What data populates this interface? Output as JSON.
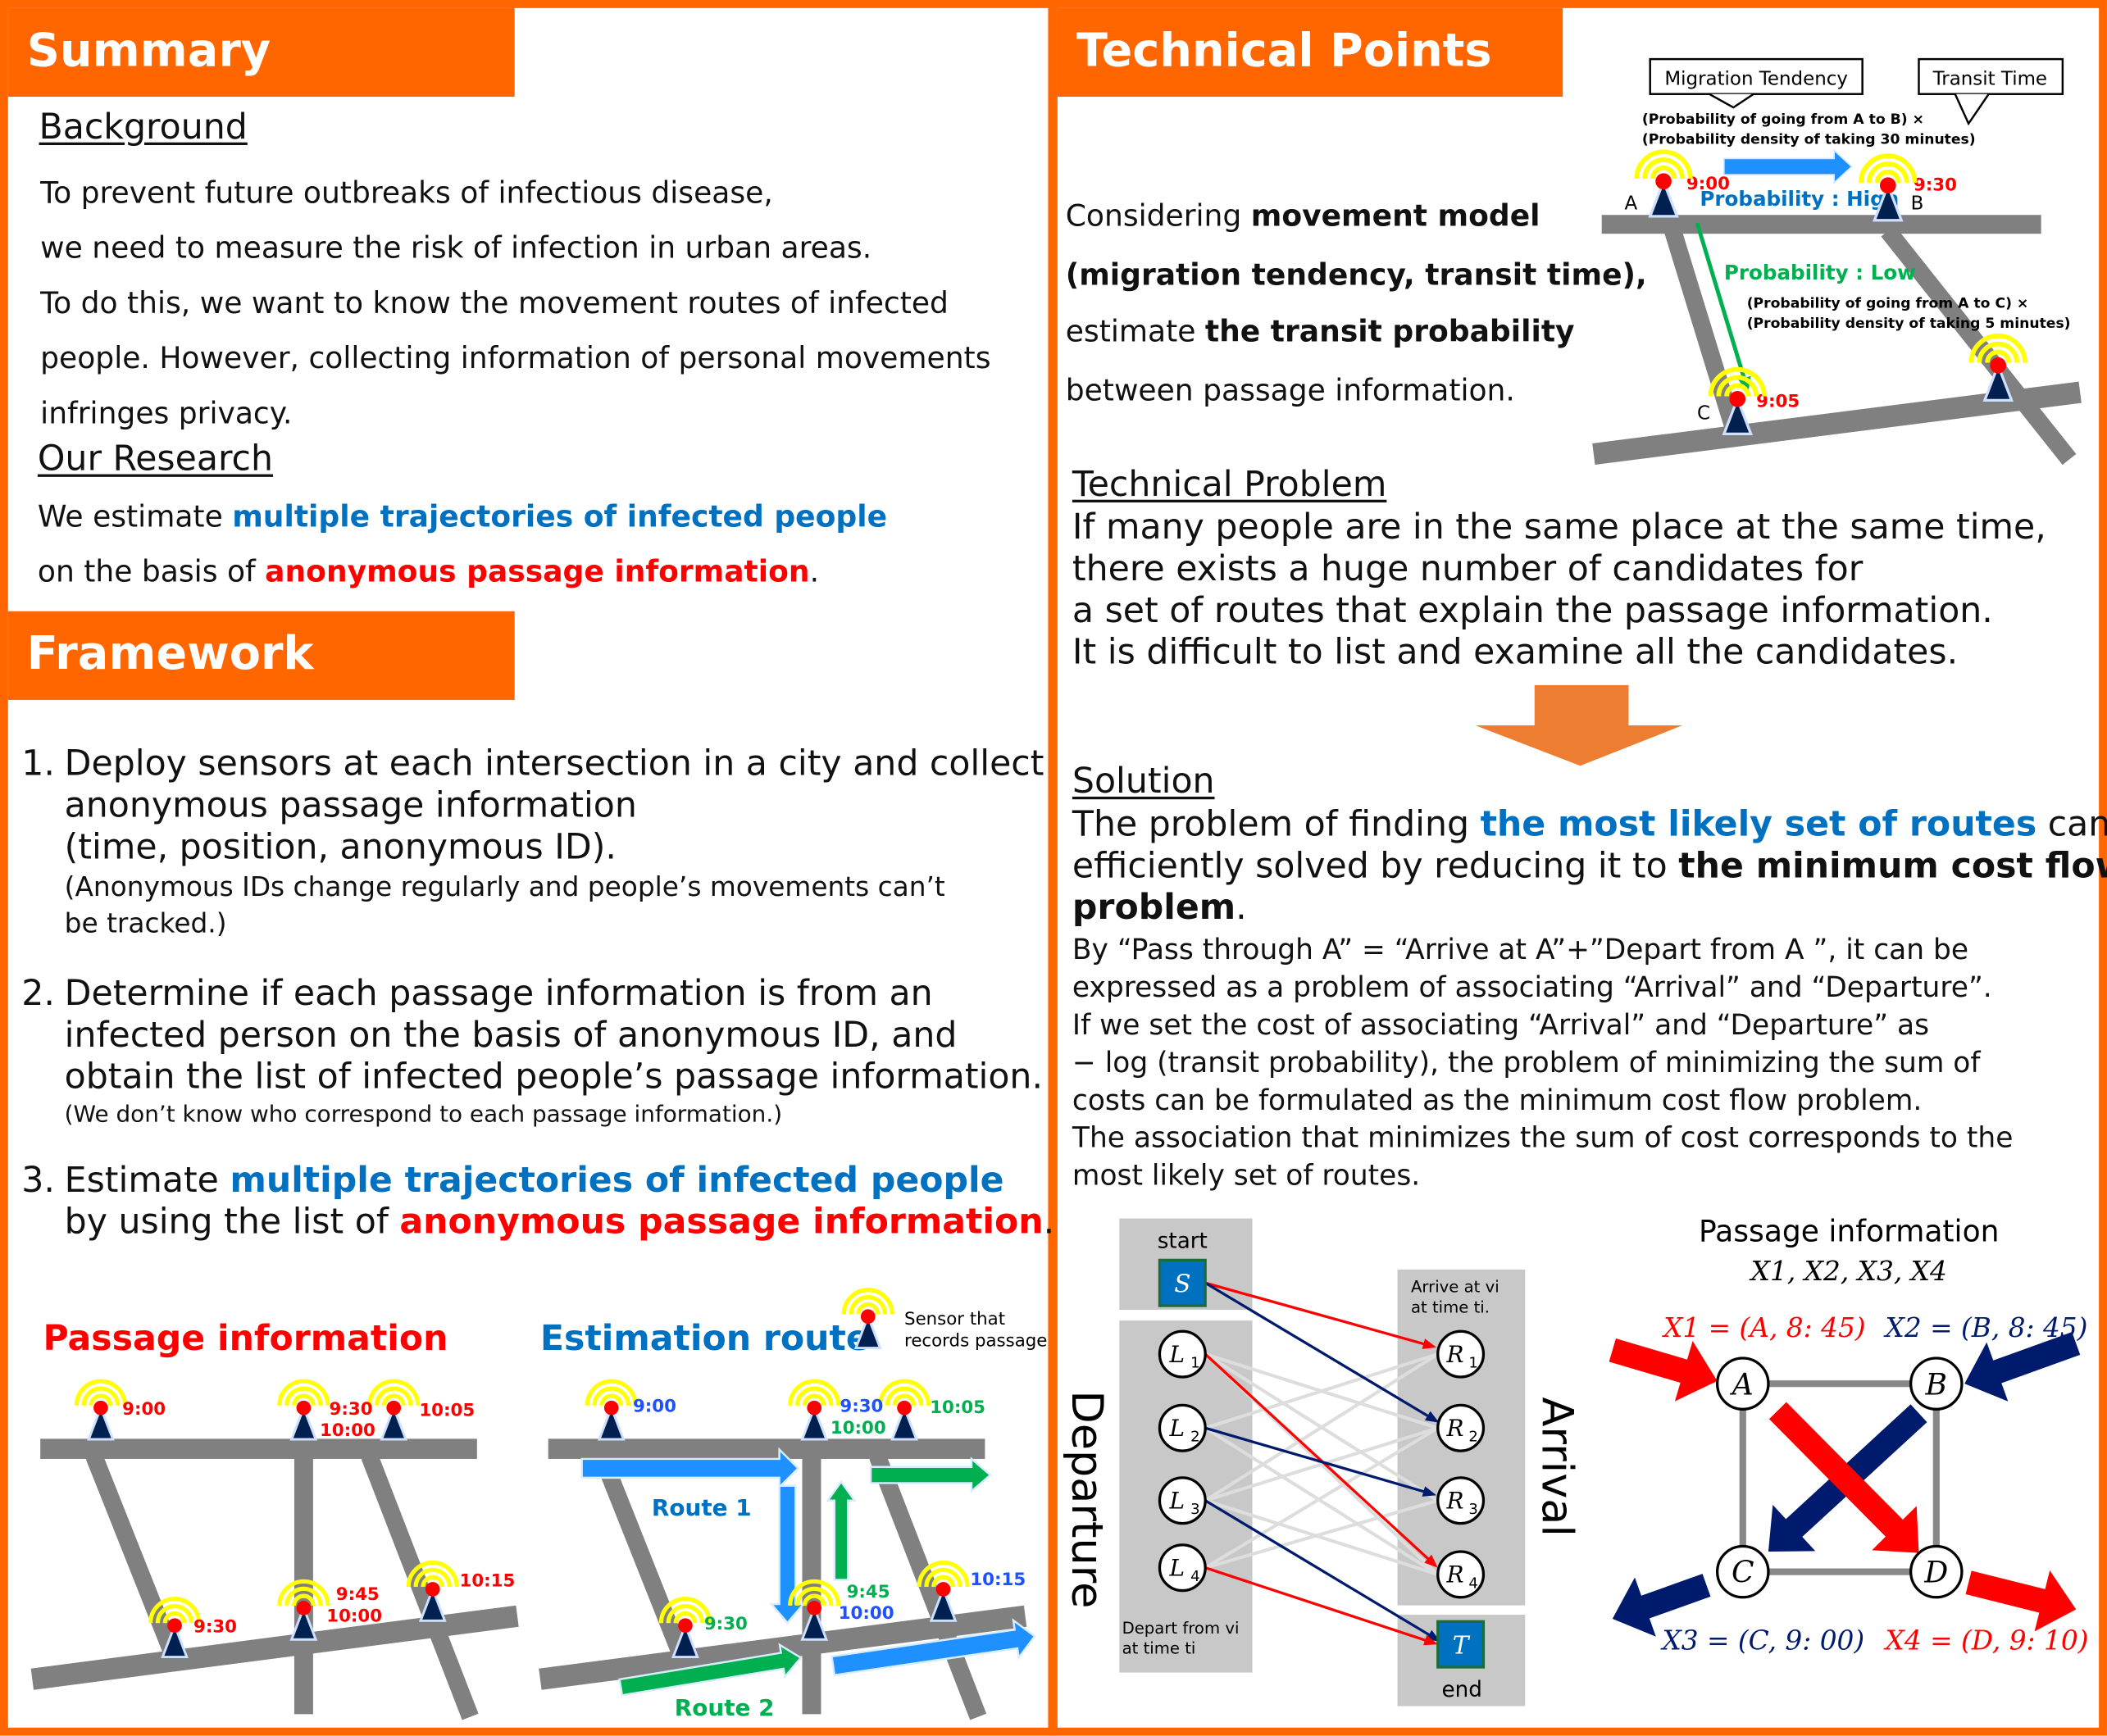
{
  "colors": {
    "orange": "#FF6600",
    "arrow_orange": "#ED7D31",
    "blue": "#0070C0",
    "red": "#FF0000",
    "green": "#00B050",
    "navy": "#001A6E",
    "road": "#808080",
    "sensor_arc": "#FFFF00",
    "sensor_dot": "#FF0000",
    "sensor_body": "#002050"
  },
  "summary": {
    "title": "Summary",
    "background_heading": "Background",
    "background_lines": [
      "To prevent future outbreaks of infectious disease,",
      "we need to measure the risk of infection in urban areas.",
      "To do this, we want to know the movement routes of infected",
      "people. However, collecting information of personal movements",
      "infringes privacy."
    ],
    "research_heading": "Our Research",
    "research_line1_a": "We estimate ",
    "research_line1_b": "multiple trajectories of infected people",
    "research_line2_a": "on the basis of ",
    "research_line2_b": "anonymous passage information",
    "research_line2_c": "."
  },
  "framework": {
    "title": "Framework",
    "item1": {
      "num": "1.",
      "lines": [
        "Deploy sensors at each intersection in a city and collect",
        "anonymous passage information",
        "(time, position, anonymous ID)."
      ],
      "note": [
        "(Anonymous IDs change regularly and people’s movements can’t",
        "be tracked.)"
      ]
    },
    "item2": {
      "num": "2.",
      "lines": [
        "Determine if each passage information is from an",
        "infected person on the basis of anonymous ID, and",
        "obtain the list of infected people’s passage information."
      ],
      "note": [
        "(We don’t know who correspond to each passage information.)"
      ]
    },
    "item3": {
      "num": "3.",
      "line1_a": "Estimate ",
      "line1_b": "multiple trajectories of infected people",
      "line2_a": "by using the list of ",
      "line2_b": "anonymous passage information",
      "line2_c": "."
    },
    "passage_title": "Passage information",
    "estimation_title": "Estimation route",
    "legend": [
      "Sensor that",
      "records passage"
    ],
    "passage_times": {
      "s1": "9:00",
      "s2a": "9:30",
      "s2b": "10:00",
      "s3": "10:05",
      "s4": "9:30",
      "s5a": "9:45",
      "s5b": "10:00",
      "s6": "10:15"
    },
    "estimation_times": {
      "s1": "9:00",
      "s2a": "9:30",
      "s2b": "10:00",
      "s3": "10:05",
      "s4": "9:30",
      "s5a": "9:45",
      "s5b": "10:00",
      "s6": "10:15"
    },
    "route1": "Route 1",
    "route2": "Route 2"
  },
  "technical": {
    "title": "Technical Points",
    "intro": {
      "l1_a": "Considering ",
      "l1_b": "movement model",
      "l2": "(migration tendency, transit time),",
      "l3_a": "estimate ",
      "l3_b": "the transit probability",
      "l4": "between passage information."
    },
    "diagram": {
      "migration": "Migration Tendency",
      "transit": "Transit Time",
      "formula_ab": [
        "(Probability of going from A to B) ×",
        "(Probability density of taking 30 minutes)"
      ],
      "formula_ac": [
        "(Probability of going from A to C) ×",
        "(Probability density of taking 5 minutes)"
      ],
      "high": "Probability : High",
      "low": "Probability : Low",
      "A": "A",
      "B": "B",
      "C": "C",
      "tA": "9:00",
      "tB": "9:30",
      "tC": "9:05"
    },
    "problem_heading": "Technical Problem",
    "problem_lines": [
      "If many people are in the same place at the same time,",
      "there exists a huge number of candidates for",
      "a set of routes that explain the passage information.",
      "It is difficult to list and examine all the candidates."
    ],
    "solution_heading": "Solution",
    "sol_l1_a": "The problem of finding ",
    "sol_l1_b": "the most likely set of routes",
    "sol_l1_c": " can be",
    "sol_l2_a": "efficiently solved by reducing it to ",
    "sol_l2_b": "the minimum cost flow",
    "sol_l3_a": "problem",
    "sol_l3_b": ".",
    "sol_small": [
      "By “Pass through A” = “Arrive at A”+”Depart from A ”, it can be",
      "expressed as a problem of associating “Arrival” and “Departure”.",
      "If we set the cost of associating “Arrival” and “Departure” as",
      "− log (transit probability), the problem of minimizing the sum of",
      "costs can be formulated as the minimum cost flow problem.",
      "The association that minimizes the sum of cost corresponds to the",
      "most likely set of routes."
    ],
    "flow": {
      "start": "start",
      "S": "S",
      "L": [
        "L1",
        "L2",
        "L3",
        "L4"
      ],
      "R": [
        "R1",
        "R2",
        "R3",
        "R4"
      ],
      "T": "T",
      "end": "end",
      "departure": "Departure",
      "arrival": "Arrival",
      "arrive_note": [
        "Arrive at vi",
        "at time ti."
      ],
      "depart_note": [
        "Depart from vi",
        "at time ti"
      ]
    },
    "passage": {
      "title": "Passage information",
      "list": "X1, X2, X3, X4",
      "x1": "X1 = (A, 8: 45)",
      "x2": "X2 = (B, 8: 45)",
      "x3": "X3 = (C, 9: 00)",
      "x4": "X4 = (D, 9: 10)",
      "nodes": [
        "A",
        "B",
        "C",
        "D"
      ]
    }
  }
}
